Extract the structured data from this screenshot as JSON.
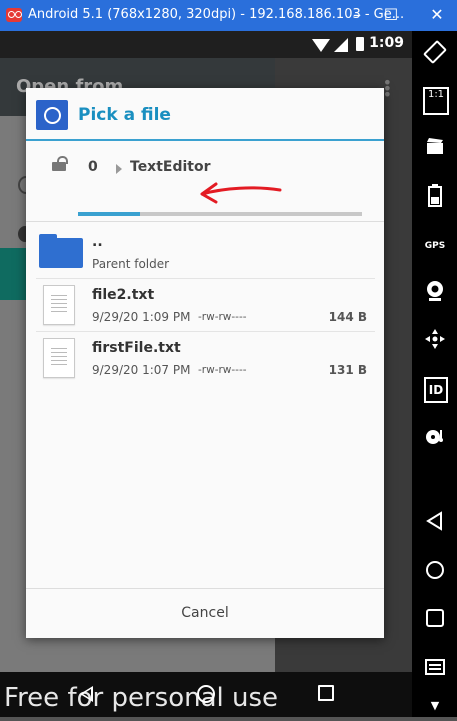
{
  "window": {
    "title": "Android 5.1 (768x1280, 320dpi) - 192.168.186.103 - Ge...",
    "minimize": "–",
    "maximize": "☐",
    "close": "✕"
  },
  "status_bar": {
    "time": "1:09"
  },
  "background_app": {
    "title": "Open from"
  },
  "dialog": {
    "title": "Pick a file",
    "breadcrumb": {
      "root": "0",
      "current": "TextEditor"
    },
    "path_progress": 0.22,
    "parent": {
      "name": "..",
      "label": "Parent folder"
    },
    "files": [
      {
        "name": "file2.txt",
        "date": "9/29/20 1:09 PM",
        "perm": "-rw-rw----",
        "size": "144 B"
      },
      {
        "name": "firstFile.txt",
        "date": "9/29/20 1:07 PM",
        "perm": "-rw-rw----",
        "size": "131 B"
      }
    ],
    "cancel": "Cancel"
  },
  "annotation_color": "#e31b23",
  "accent_color": "#3aa1d0",
  "watermark": "Free for personal use",
  "side_toolbar": {
    "icons": [
      "rotate-icon",
      "pixel-perfect-icon",
      "camera-icon",
      "battery-icon",
      "gps-icon",
      "webcam-icon",
      "move-icon",
      "id-icon",
      "media-icon",
      "back-icon",
      "home-icon",
      "recent-apps-icon",
      "menu-icon"
    ],
    "pixel_label": "1:1",
    "gps_label": "GPS",
    "id_label": "ID"
  }
}
